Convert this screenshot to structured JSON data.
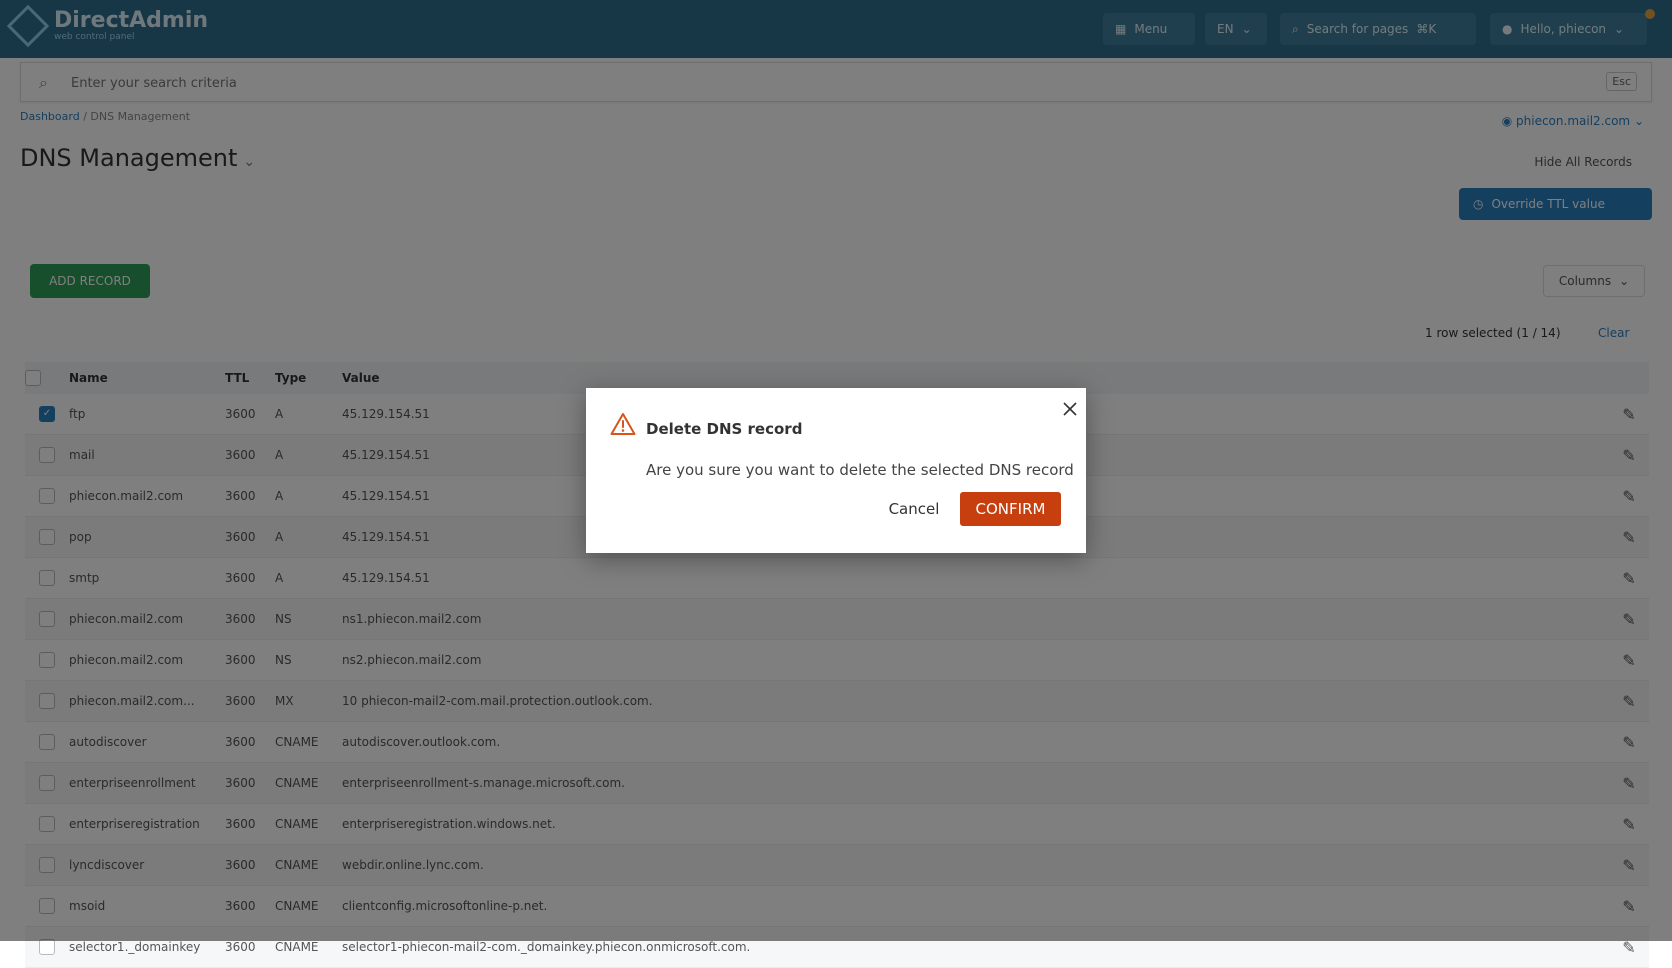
{
  "header": {
    "logo_text": "DirectAdmin",
    "logo_sub": "web control panel",
    "menu_label": "Menu",
    "lang_label": "EN",
    "search_pages_label": "Search for pages",
    "search_pages_kbd": "⌘K",
    "user_label": "Hello, phiecon"
  },
  "search": {
    "placeholder": "Enter your search criteria",
    "kbd": "Esc"
  },
  "breadcrumb": {
    "root": "Dashboard",
    "separator": "/",
    "current": "DNS Management"
  },
  "domain_selector": "phiecon.mail2.com",
  "page_title": "DNS Management",
  "show_all_label": "Hide All Records",
  "ttl_button_label": "Override TTL value",
  "add_record_label": "ADD RECORD",
  "columns_label": "Columns",
  "selection": {
    "info": "1 row selected (1 / 14)",
    "clear": "Clear"
  },
  "table": {
    "headers": [
      "Name",
      "TTL",
      "Type",
      "Value"
    ],
    "rows": [
      {
        "name": "ftp",
        "ttl": "3600",
        "type": "A",
        "value": "45.129.154.51",
        "checked": true
      },
      {
        "name": "mail",
        "ttl": "3600",
        "type": "A",
        "value": "45.129.154.51",
        "checked": false
      },
      {
        "name": "phiecon.mail2.com",
        "ttl": "3600",
        "type": "A",
        "value": "45.129.154.51",
        "checked": false
      },
      {
        "name": "pop",
        "ttl": "3600",
        "type": "A",
        "value": "45.129.154.51",
        "checked": false
      },
      {
        "name": "smtp",
        "ttl": "3600",
        "type": "A",
        "value": "45.129.154.51",
        "checked": false
      },
      {
        "name": "phiecon.mail2.com",
        "ttl": "3600",
        "type": "NS",
        "value": "ns1.phiecon.mail2.com",
        "checked": false
      },
      {
        "name": "phiecon.mail2.com",
        "ttl": "3600",
        "type": "NS",
        "value": "ns2.phiecon.mail2.com",
        "checked": false
      },
      {
        "name": "phiecon.mail2.com...",
        "ttl": "3600",
        "type": "MX",
        "value": "10 phiecon-mail2-com.mail.protection.outlook.com.",
        "checked": false
      },
      {
        "name": "autodiscover",
        "ttl": "3600",
        "type": "CNAME",
        "value": "autodiscover.outlook.com.",
        "checked": false
      },
      {
        "name": "enterpriseenrollment",
        "ttl": "3600",
        "type": "CNAME",
        "value": "enterpriseenrollment-s.manage.microsoft.com.",
        "checked": false
      },
      {
        "name": "enterpriseregistration",
        "ttl": "3600",
        "type": "CNAME",
        "value": "enterpriseregistration.windows.net.",
        "checked": false
      },
      {
        "name": "lyncdiscover",
        "ttl": "3600",
        "type": "CNAME",
        "value": "webdir.online.lync.com.",
        "checked": false
      },
      {
        "name": "msoid",
        "ttl": "3600",
        "type": "CNAME",
        "value": "clientconfig.microsoftonline-p.net.",
        "checked": false
      },
      {
        "name": "selector1._domainkey",
        "ttl": "3600",
        "type": "CNAME",
        "value": "selector1-phiecon-mail2-com._domainkey.phiecon.onmicrosoft.com.",
        "checked": false
      }
    ]
  },
  "modal": {
    "title": "Delete DNS record",
    "message": "Are you sure you want to delete the selected DNS record",
    "cancel": "Cancel",
    "confirm": "CONFIRM"
  },
  "colors": {
    "confirm": "#c83f0f",
    "warning_icon": "#d9541a",
    "topbar": "#2f6f8f",
    "primary": "#2a7fbf",
    "success": "#2e9e5b"
  }
}
